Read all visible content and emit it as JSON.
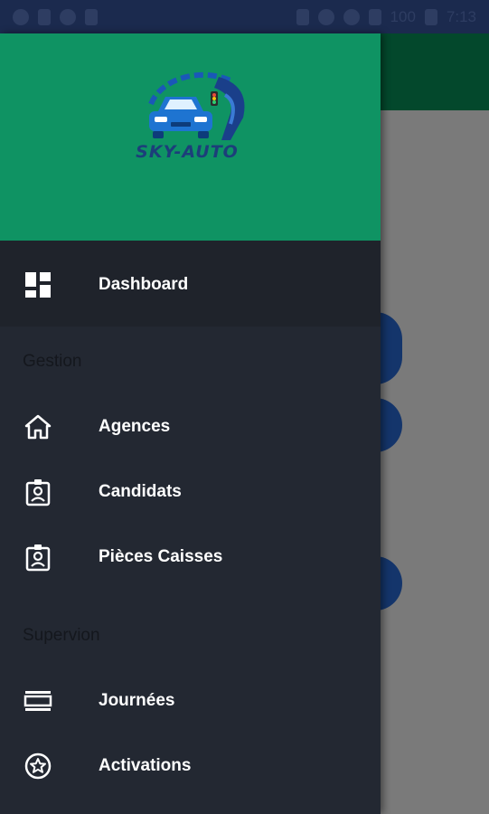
{
  "status_bar": {
    "battery_text": "100",
    "time": "7:13"
  },
  "drawer": {
    "logo_text": "SKY-AUTO",
    "items": [
      {
        "label": "Dashboard",
        "icon": "dashboard-icon"
      }
    ],
    "sections": [
      {
        "title": "Gestion",
        "items": [
          {
            "label": "Agences",
            "icon": "home-icon"
          },
          {
            "label": "Candidats",
            "icon": "badge-icon"
          },
          {
            "label": "Pièces Caisses",
            "icon": "badge-icon"
          }
        ]
      },
      {
        "title": "Supervion",
        "items": [
          {
            "label": "Journées",
            "icon": "view-day-icon"
          },
          {
            "label": "Activations",
            "icon": "star-circle-icon"
          }
        ]
      }
    ]
  },
  "colors": {
    "status_bar": "#1b2a4e",
    "drawer_header": "#0f9363",
    "drawer_bg": "#232832",
    "active_item_bg": "#1f232b",
    "app_bar": "#03482c"
  }
}
